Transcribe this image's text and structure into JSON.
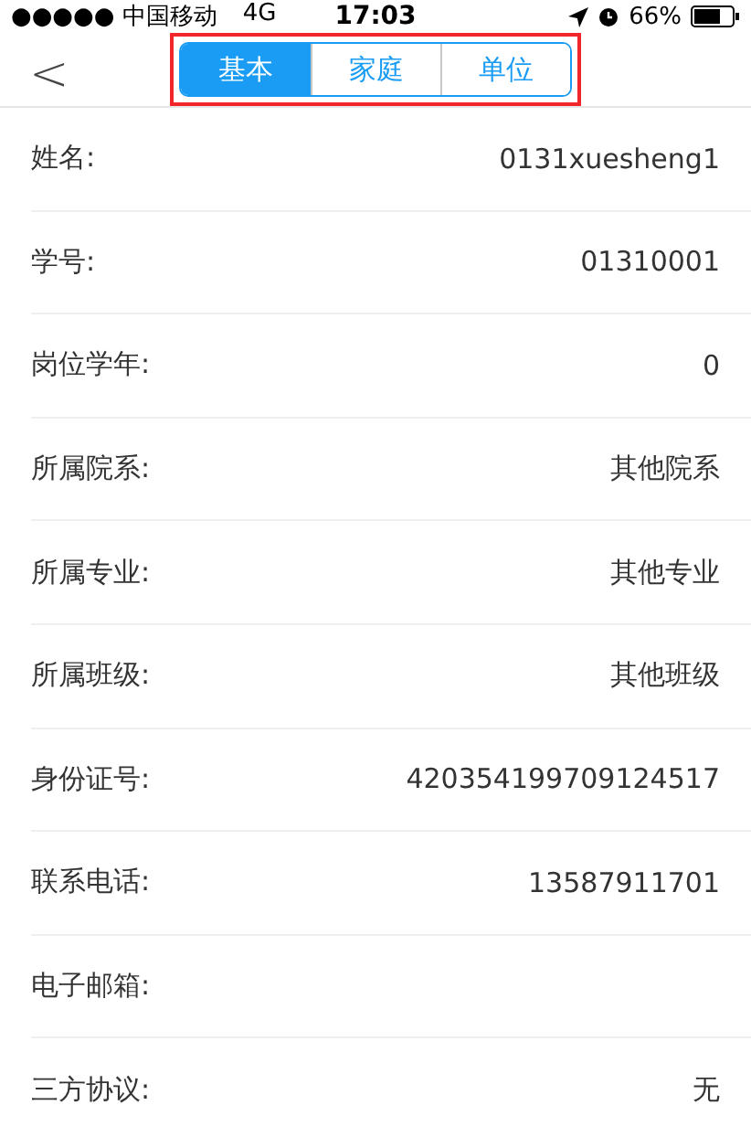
{
  "status_bar": {
    "carrier": "●●●●● 中国移动",
    "network": "4G",
    "time": "17:03",
    "battery": "66%"
  },
  "nav": {
    "back": "<",
    "tabs": [
      {
        "label": "基本",
        "selected": true
      },
      {
        "label": "家庭",
        "selected": false
      },
      {
        "label": "单位",
        "selected": false
      }
    ]
  },
  "rows": [
    {
      "label": "姓名:",
      "value": "0131xuesheng1"
    },
    {
      "label": "学号:",
      "value": "01310001"
    },
    {
      "label": "岗位学年:",
      "value": "0"
    },
    {
      "label": "所属院系:",
      "value": "其他院系"
    },
    {
      "label": "所属专业:",
      "value": "其他专业"
    },
    {
      "label": "所属班级:",
      "value": "其他班级"
    },
    {
      "label": "身份证号:",
      "value": "420354199709124517"
    },
    {
      "label": "联系电话:",
      "value": "13587911701"
    },
    {
      "label": "电子邮箱:"
    },
    {
      "label": "三方协议:",
      "value": "无"
    }
  ]
}
